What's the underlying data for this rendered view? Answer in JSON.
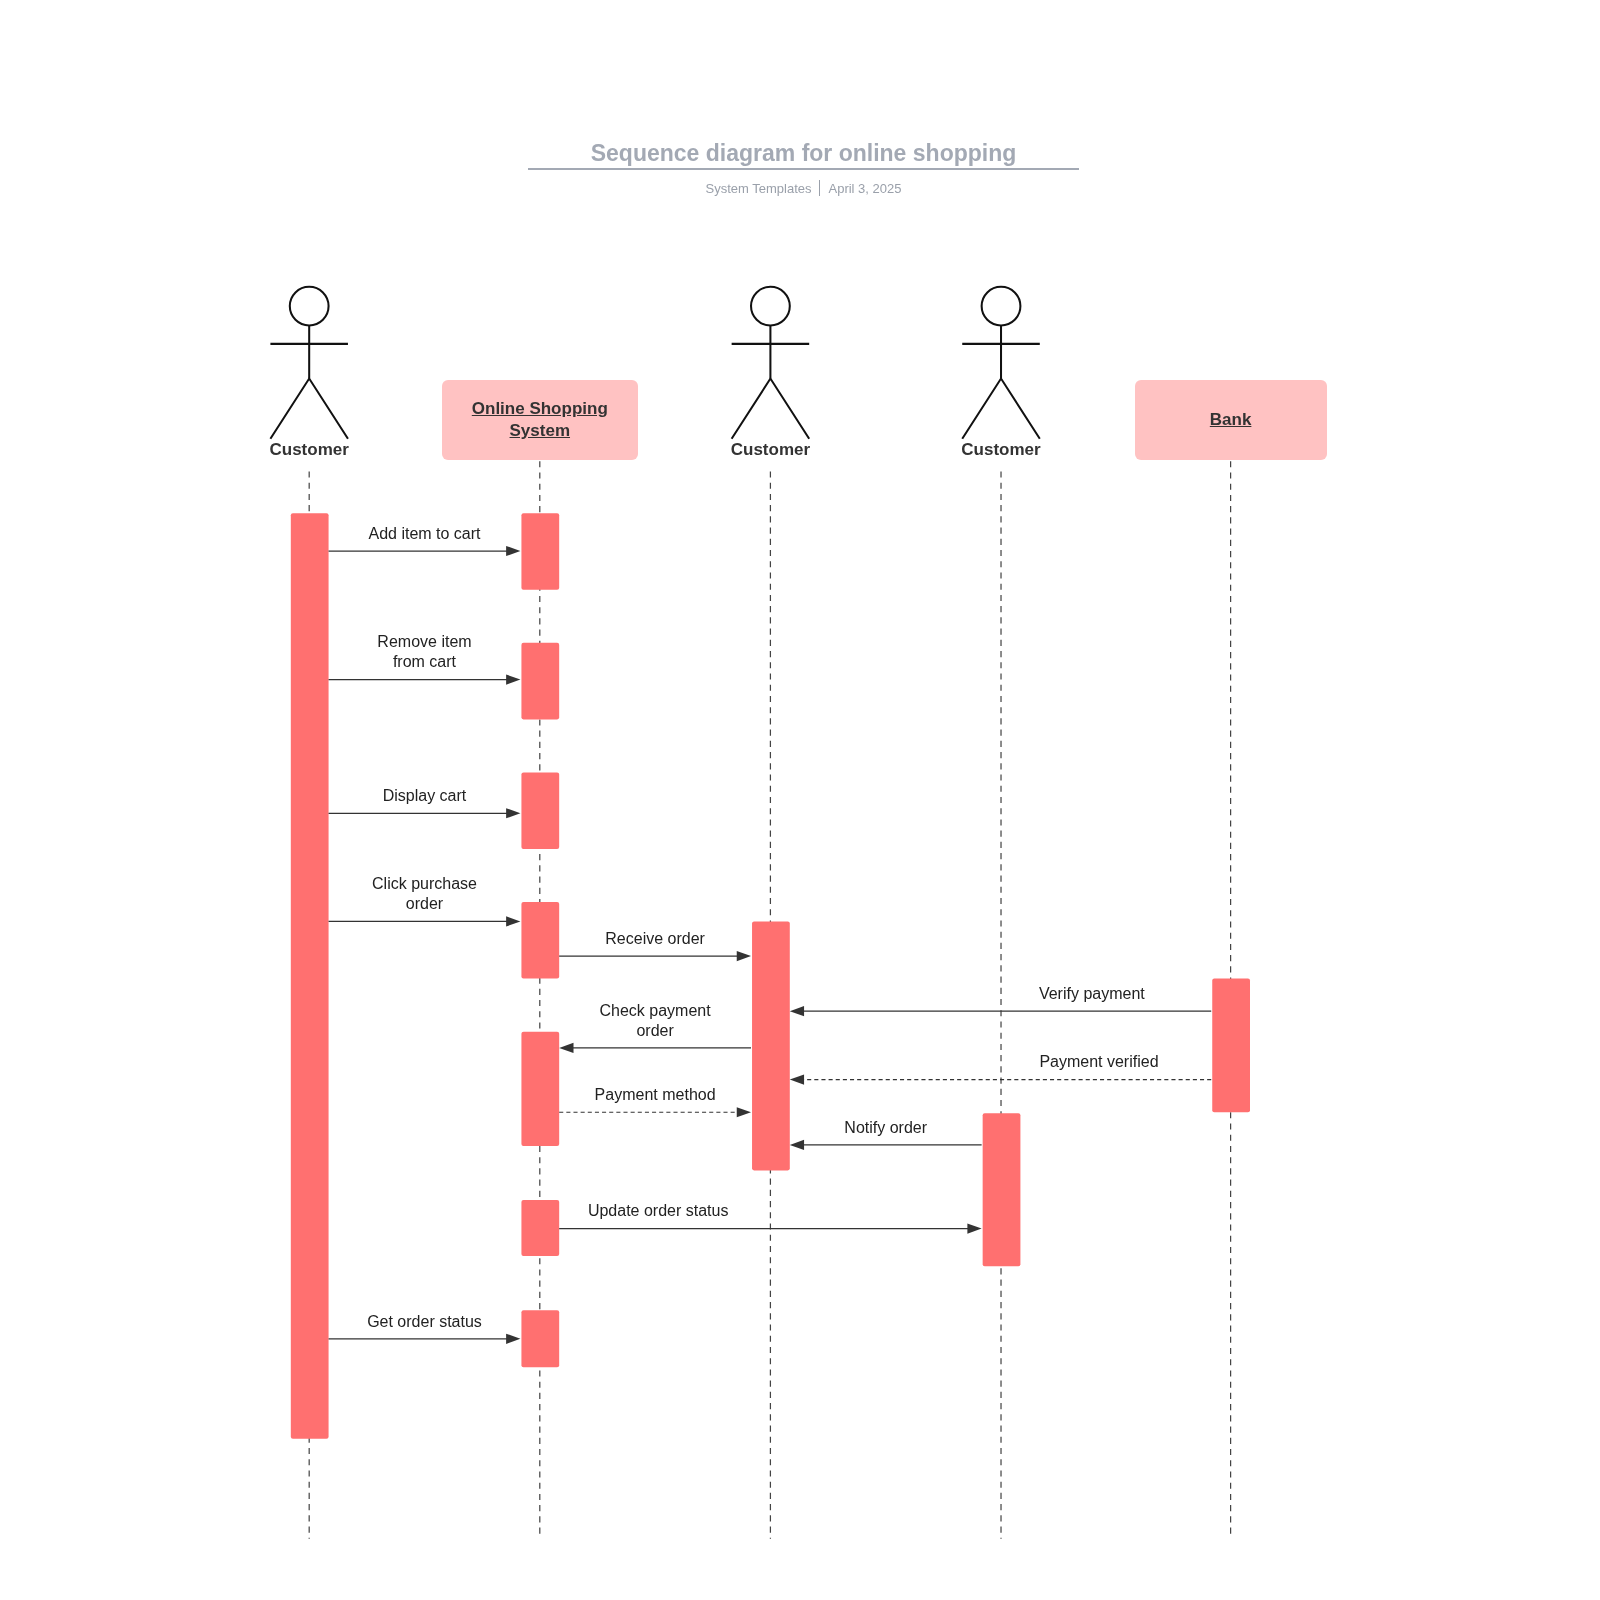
{
  "title": "Sequence diagram for online shopping",
  "subtitle": {
    "source": "System Templates",
    "date": "April 3, 2025"
  },
  "lifelines": [
    {
      "kind": "actor",
      "label": "Customer"
    },
    {
      "kind": "object",
      "label": "Online Shopping System"
    },
    {
      "kind": "actor",
      "label": "Customer"
    },
    {
      "kind": "actor",
      "label": "Customer"
    },
    {
      "kind": "object",
      "label": "Bank"
    }
  ],
  "messages": [
    {
      "label": "Add item to cart",
      "kind": "call"
    },
    {
      "label": "Remove item from cart",
      "kind": "call"
    },
    {
      "label": "Display cart",
      "kind": "call"
    },
    {
      "label": "Click purchase order",
      "kind": "call"
    },
    {
      "label": "Receive order",
      "kind": "call"
    },
    {
      "label": "Verify payment",
      "kind": "call"
    },
    {
      "label": "Check payment order",
      "kind": "call"
    },
    {
      "label": "Payment verified",
      "kind": "reply"
    },
    {
      "label": "Payment method",
      "kind": "reply"
    },
    {
      "label": "Notify order",
      "kind": "call"
    },
    {
      "label": "Update order status",
      "kind": "call"
    },
    {
      "label": "Get order status",
      "kind": "call"
    }
  ]
}
